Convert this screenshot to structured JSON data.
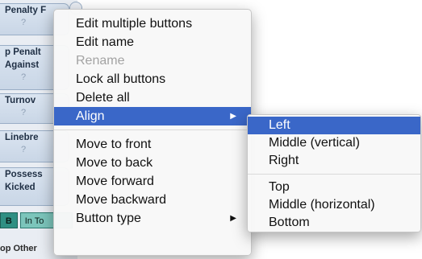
{
  "background_buttons": [
    {
      "label_lines": [
        "Penalty F"
      ],
      "value": "?"
    },
    {
      "label_lines": [
        "p Penalt",
        "Against"
      ],
      "value": "?"
    },
    {
      "label_lines": [
        "Turnov"
      ],
      "value": "?"
    },
    {
      "label_lines": [
        "Linebre"
      ],
      "value": "?"
    },
    {
      "label_lines": [
        "Possess",
        "Kicked"
      ],
      "value": "?"
    }
  ],
  "bottom_tabs": {
    "left": "B",
    "right": "In To"
  },
  "bottom_label": "op Other",
  "context_menu": {
    "items": [
      {
        "label": "Edit multiple buttons"
      },
      {
        "label": "Edit name"
      },
      {
        "label": "Rename",
        "disabled": true
      },
      {
        "label": "Lock all buttons"
      },
      {
        "label": "Delete all"
      },
      {
        "label": "Align",
        "submenu": true,
        "highlighted": true
      },
      {
        "label": "Move to front"
      },
      {
        "label": "Move to back"
      },
      {
        "label": "Move forward"
      },
      {
        "label": "Move backward"
      },
      {
        "label": "Button type",
        "submenu": true
      }
    ],
    "submenu_arrow": "▶"
  },
  "align_submenu": {
    "items": [
      {
        "label": "Left",
        "highlighted": true
      },
      {
        "label": "Middle (vertical)"
      },
      {
        "label": "Right"
      },
      {
        "label": "Top"
      },
      {
        "label": "Middle (horizontal)"
      },
      {
        "label": "Bottom"
      }
    ]
  },
  "colors": {
    "highlight": "#3a67c8",
    "menu_background": "#f8f8f8",
    "disabled_text": "#a3a3a3",
    "button_fill": "#dbe5f1",
    "tab_teal": "#2f8f83"
  }
}
